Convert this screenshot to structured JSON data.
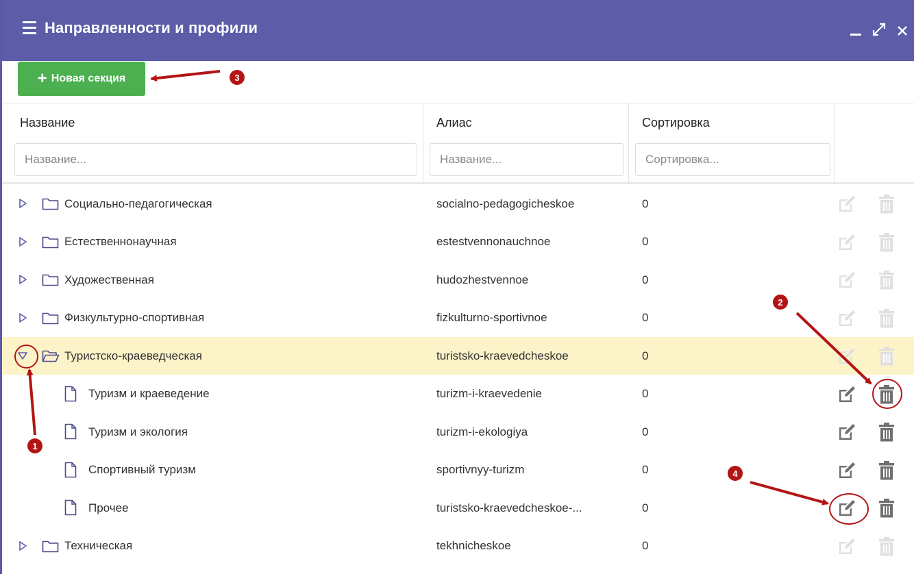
{
  "window": {
    "title": "Направленности и профили",
    "controls": [
      "minimize-icon",
      "maximize-icon",
      "close-icon"
    ]
  },
  "toolbar": {
    "new_section_label": "Новая секция"
  },
  "table": {
    "headers": {
      "name": "Название",
      "alias": "Алиас",
      "sort": "Сортировка"
    },
    "filters": {
      "name_placeholder": "Название...",
      "alias_placeholder": "Название...",
      "sort_placeholder": "Сортировка..."
    },
    "rows": [
      {
        "name": "Социально-педагогическая",
        "alias": "socialno-pedagogicheskoe",
        "sort": "0",
        "type": "folder",
        "expanded": false,
        "actions_enabled": false
      },
      {
        "name": "Естественнонаучная",
        "alias": "estestvennonauchnoe",
        "sort": "0",
        "type": "folder",
        "expanded": false,
        "actions_enabled": false
      },
      {
        "name": "Художественная",
        "alias": "hudozhestvennoe",
        "sort": "0",
        "type": "folder",
        "expanded": false,
        "actions_enabled": false
      },
      {
        "name": "Физкультурно-спортивная",
        "alias": "fizkulturno-sportivnoe",
        "sort": "0",
        "type": "folder",
        "expanded": false,
        "actions_enabled": false
      },
      {
        "name": "Туристско-краеведческая",
        "alias": "turistsko-kraevedcheskoe",
        "sort": "0",
        "type": "folder",
        "expanded": true,
        "selected": true,
        "actions_enabled": false
      },
      {
        "name": "Туризм и краеведение",
        "alias": "turizm-i-kraevedenie",
        "sort": "0",
        "type": "file",
        "actions_enabled": true
      },
      {
        "name": "Туризм и экология",
        "alias": "turizm-i-ekologiya",
        "sort": "0",
        "type": "file",
        "actions_enabled": true
      },
      {
        "name": "Спортивный туризм",
        "alias": "sportivnyy-turizm",
        "sort": "0",
        "type": "file",
        "actions_enabled": true
      },
      {
        "name": "Прочее",
        "alias": "turistsko-kraevedcheskoe-...",
        "sort": "0",
        "type": "file",
        "actions_enabled": true
      },
      {
        "name": "Техническая",
        "alias": "tekhnicheskoe",
        "sort": "0",
        "type": "folder",
        "expanded": false,
        "actions_enabled": false
      }
    ]
  },
  "annotations": [
    "1",
    "2",
    "3",
    "4"
  ],
  "colors": {
    "titlebar": "#5c5ca9",
    "new_button": "#4caf50",
    "selected_row": "#fdf3c9",
    "annotation": "#b41414",
    "icon_enabled": "#707070",
    "icon_disabled": "#e0e0e0"
  }
}
